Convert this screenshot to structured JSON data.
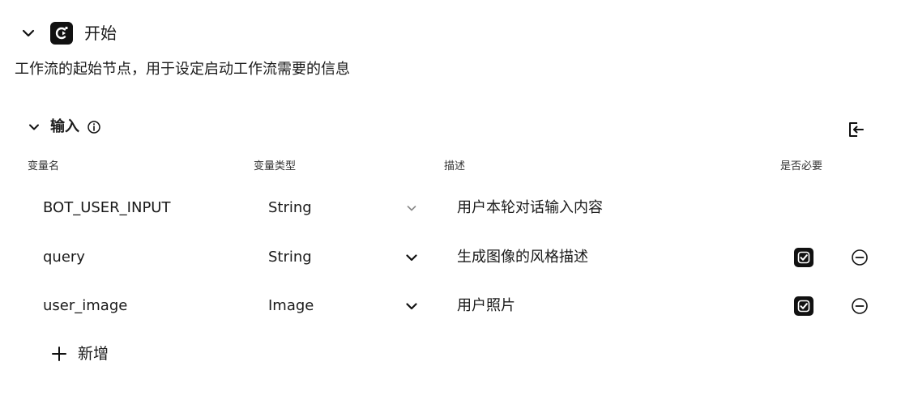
{
  "node": {
    "title": "开始",
    "description": "工作流的起始节点，用于设定启动工作流需要的信息",
    "icon": "start-node-icon"
  },
  "input_section": {
    "title": "输入",
    "columns": {
      "name": "变量名",
      "type": "变量类型",
      "description": "描述",
      "required": "是否必要"
    },
    "rows": [
      {
        "name": "BOT_USER_INPUT",
        "type": "String",
        "description": "用户本轮对话输入内容",
        "required": null,
        "removable": false
      },
      {
        "name": "query",
        "type": "String",
        "description": "生成图像的风格描述",
        "required": true,
        "removable": true
      },
      {
        "name": "user_image",
        "type": "Image",
        "description": "用户照片",
        "required": true,
        "removable": true
      }
    ],
    "add_label": "新增"
  },
  "colors": {
    "text": "#1a1a1a",
    "icon_dark": "#111111",
    "background": "#ffffff"
  }
}
